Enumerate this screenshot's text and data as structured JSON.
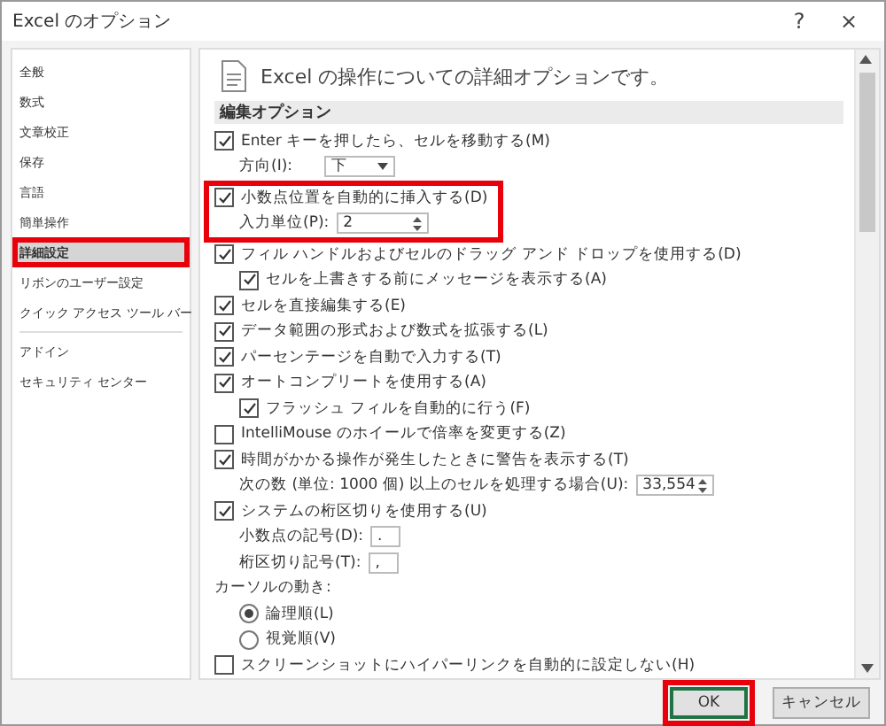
{
  "window": {
    "title": "Excel のオプション",
    "help": "?",
    "close": "×"
  },
  "sidebar": {
    "groups": [
      {
        "items": [
          {
            "label": "全般",
            "selected": false,
            "highlighted": false
          },
          {
            "label": "数式",
            "selected": false,
            "highlighted": false
          },
          {
            "label": "文章校正",
            "selected": false,
            "highlighted": false
          },
          {
            "label": "保存",
            "selected": false,
            "highlighted": false
          },
          {
            "label": "言語",
            "selected": false,
            "highlighted": false
          },
          {
            "label": "簡単操作",
            "selected": false,
            "highlighted": false
          },
          {
            "label": "詳細設定",
            "selected": true,
            "highlighted": true
          },
          {
            "label": "リボンのユーザー設定",
            "selected": false,
            "highlighted": false
          },
          {
            "label": "クイック アクセス ツール バー",
            "selected": false,
            "highlighted": false
          }
        ]
      },
      {
        "items": [
          {
            "label": "アドイン",
            "selected": false,
            "highlighted": false
          },
          {
            "label": "セキュリティ センター",
            "selected": false,
            "highlighted": false
          }
        ]
      }
    ]
  },
  "panel": {
    "title": "Excel の操作についての詳細オプションです。",
    "section": "編集オプション",
    "rows": [
      {
        "kind": "checkbox",
        "label": "Enter キーを押したら、セルを移動する(M)",
        "checked": true,
        "children": [
          {
            "kind": "select",
            "label": "方向(I):",
            "value": "下"
          }
        ]
      },
      {
        "kind": "checkbox",
        "label": "小数点位置を自動的に挿入する(D)",
        "checked": true,
        "highlighted": true,
        "children": [
          {
            "kind": "spinner",
            "label": "入力単位(P):",
            "value": "2"
          }
        ]
      },
      {
        "kind": "checkbox",
        "label": "フィル ハンドルおよびセルのドラッグ アンド ドロップを使用する(D)",
        "checked": true,
        "children": [
          {
            "kind": "checkbox",
            "label": "セルを上書きする前にメッセージを表示する(A)",
            "checked": true
          }
        ]
      },
      {
        "kind": "checkbox",
        "label": "セルを直接編集する(E)",
        "checked": true
      },
      {
        "kind": "checkbox",
        "label": "データ範囲の形式および数式を拡張する(L)",
        "checked": true
      },
      {
        "kind": "checkbox",
        "label": "パーセンテージを自動で入力する(T)",
        "checked": true
      },
      {
        "kind": "checkbox",
        "label": "オートコンプリートを使用する(A)",
        "checked": true,
        "children": [
          {
            "kind": "checkbox",
            "label": "フラッシュ フィルを自動的に行う(F)",
            "checked": true
          }
        ]
      },
      {
        "kind": "checkbox",
        "label": "IntelliMouse のホイールで倍率を変更する(Z)",
        "checked": false
      },
      {
        "kind": "checkbox",
        "label": "時間がかかる操作が発生したときに警告を表示する(T)",
        "checked": true,
        "children": [
          {
            "kind": "spinner",
            "label": "次の数 (単位: 1000 個) 以上のセルを処理する場合(U):",
            "value": "33,554"
          }
        ]
      },
      {
        "kind": "checkbox",
        "label": "システムの桁区切りを使用する(U)",
        "checked": true,
        "children": [
          {
            "kind": "text-field",
            "label": "小数点の記号(D):",
            "value": "."
          },
          {
            "kind": "text-field",
            "label": "桁区切り記号(T):",
            "value": ","
          }
        ]
      },
      {
        "kind": "heading",
        "label": "カーソルの動き:",
        "children": [
          {
            "kind": "radio",
            "label": "論理順(L)",
            "selected": true
          },
          {
            "kind": "radio",
            "label": "視覚順(V)",
            "selected": false
          }
        ]
      },
      {
        "kind": "checkbox",
        "label": "スクリーンショットにハイパーリンクを自動的に設定しない(H)",
        "checked": false
      }
    ]
  },
  "buttons": [
    {
      "label": "OK",
      "default": true,
      "highlighted": true
    },
    {
      "label": "キャンセル",
      "default": false,
      "highlighted": false
    }
  ]
}
